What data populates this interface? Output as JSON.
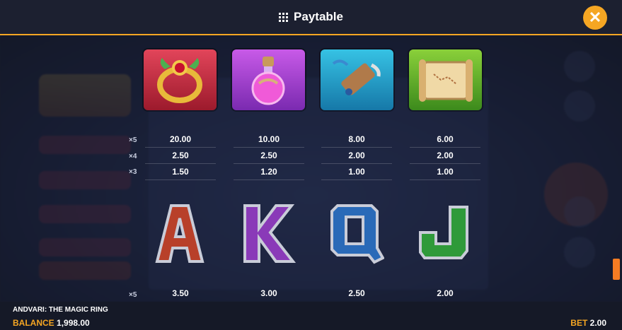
{
  "header": {
    "title": "Paytable",
    "close_label": "✕"
  },
  "symbols_top": [
    {
      "name": "ring",
      "pays": {
        "x5": "20.00",
        "x4": "2.50",
        "x3": "1.50"
      }
    },
    {
      "name": "potion",
      "pays": {
        "x5": "10.00",
        "x4": "2.50",
        "x3": "1.20"
      }
    },
    {
      "name": "horn",
      "pays": {
        "x5": "8.00",
        "x4": "2.00",
        "x3": "1.00"
      }
    },
    {
      "name": "map",
      "pays": {
        "x5": "6.00",
        "x4": "2.00",
        "x3": "1.00"
      }
    }
  ],
  "multipliers": {
    "x5": "×5",
    "x4": "×4",
    "x3": "×3"
  },
  "symbols_bottom": [
    {
      "letter": "A",
      "color": "#b8402a",
      "x5": "3.50"
    },
    {
      "letter": "K",
      "color": "#8a3ab8",
      "x5": "3.00"
    },
    {
      "letter": "Q",
      "color": "#2a6ab8",
      "x5": "2.50"
    },
    {
      "letter": "J",
      "color": "#2f9a3a",
      "x5": "2.00"
    }
  ],
  "footer": {
    "game_name": "ANDVARI: THE MAGIC RING",
    "balance_label": "BALANCE",
    "balance_value": "1,998.00",
    "bet_label": "BET",
    "bet_value": "2.00"
  },
  "colors": {
    "accent": "#f5a623",
    "header_bg": "#1c2030"
  }
}
